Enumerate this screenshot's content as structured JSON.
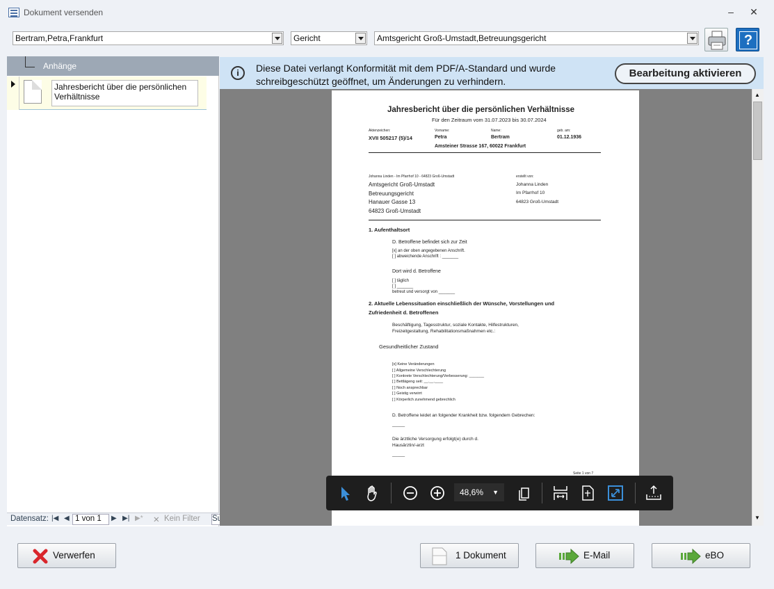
{
  "window": {
    "title": "Dokument versenden",
    "minimize": "–",
    "close": "✕"
  },
  "header": {
    "person": "Bertram,Petra,Frankfurt",
    "recipient_type": "Gericht",
    "recipient": "Amtsgericht Groß-Umstadt,Betreuungsgericht",
    "print_icon": "printer-icon",
    "help_icon": "help-icon",
    "help_glyph": "?"
  },
  "attachments": {
    "header": "Anhänge",
    "items": [
      {
        "name": "Jahresbericht über die persönlichen Verhältnisse"
      }
    ],
    "nav": {
      "label": "Datensatz:",
      "position": "1 von 1",
      "filter": "Kein Filter",
      "search": "Su"
    }
  },
  "info_bar": {
    "message": "Diese Datei verlangt Konformität mit dem PDF/A-Standard und wurde schreibgeschützt geöffnet, um Änderungen zu verhindern.",
    "button": "Bearbeitung aktivieren",
    "icon_glyph": "i"
  },
  "document": {
    "title": "Jahresbericht über die persönlichen Verhältnisse",
    "period": "Für den Zeitraum vom 31.07.2023 bis 30.07.2024",
    "fields": {
      "aktz_label": "Aktenzeichen:",
      "aktz": "XVII 505217 (5)/14",
      "vorname_label": "Vorname:",
      "vorname": "Petra",
      "name_label": "Name:",
      "name": "Bertram",
      "geb_label": "geb. am:",
      "geb": "01.12.1936",
      "address": "Amsteiner Strasse 167, 60022 Frankfurt"
    },
    "sender_line": "Johanna Linden - Im Pfarrhof 10 - 64823 Groß-Umstadt",
    "recipient_lines": [
      "Amtsgericht Groß-Umstadt",
      "Betreuungsgericht",
      "Hanauer Gasse 13",
      "64823 Groß-Umstadt"
    ],
    "created_by_label": "erstellt von:",
    "created_by_lines": [
      "Johanna Linden",
      "Im Pfarrhof 10",
      "64823 Groß-Umstadt"
    ],
    "sec1_title": "1. Aufenthaltsort",
    "sec1_lines": [
      "D. Betroffene befindet sich zur Zeit",
      "[x] an der oben angegebenen Anschrift.",
      "[ ] abweichende Anschrift : _______",
      "Dort wird d. Betroffene",
      "[ ] täglich",
      "[ ] _______",
      "betreut und versorgt von _______"
    ],
    "sec2_title_a": "2. Aktuelle Lebenssituation einschließlich der Wünsche, Vorstellungen und",
    "sec2_title_b": "Zufriedenheit d. Betroffenen",
    "sec2_lines": [
      "Beschäftigung, Tagesstruktur, soziale Kontakte, Hilfestrukturen,",
      "Freizeitgestaltung, Rehabilitationsmaßnahmen etc.:"
    ],
    "health_title": "Gesundheitlicher Zustand",
    "health_lines": [
      "[x] Keine Veränderungen",
      "[ ] Allgemeine Verschlechterung",
      "[ ] Konkrete Verschlechterung/Verbesserung: _______",
      "[ ] Bettlägeng seit: __.__.____",
      "[ ] Noch ansprechbar",
      "[ ] Geistig verwirrt",
      "[ ] Körperlich zunehmend gebrechlich"
    ],
    "illness": "D. Betroffene leidet an folgender Krankheit bzw. folgendem Gebrechen:",
    "blank": "_____",
    "care_a": "Die ärztliche Versorgung erfolgt(e) durch d.",
    "care_b": "Hausärztin/-arzt",
    "page_footer": "Seite 1 von 7"
  },
  "pdf_toolbar": {
    "zoom": "48,6%"
  },
  "buttons": {
    "discard": "Verwerfen",
    "documents": "1 Dokument",
    "email": "E-Mail",
    "ebo": "eBO"
  },
  "colors": {
    "info_bg": "#cfe3f5",
    "viewer_bg": "#808080",
    "toolbar_bg": "#1e1e1e",
    "accent_blue": "#3b8fd9",
    "discard_red": "#d9262c",
    "arrow_green": "#5aa83a"
  }
}
